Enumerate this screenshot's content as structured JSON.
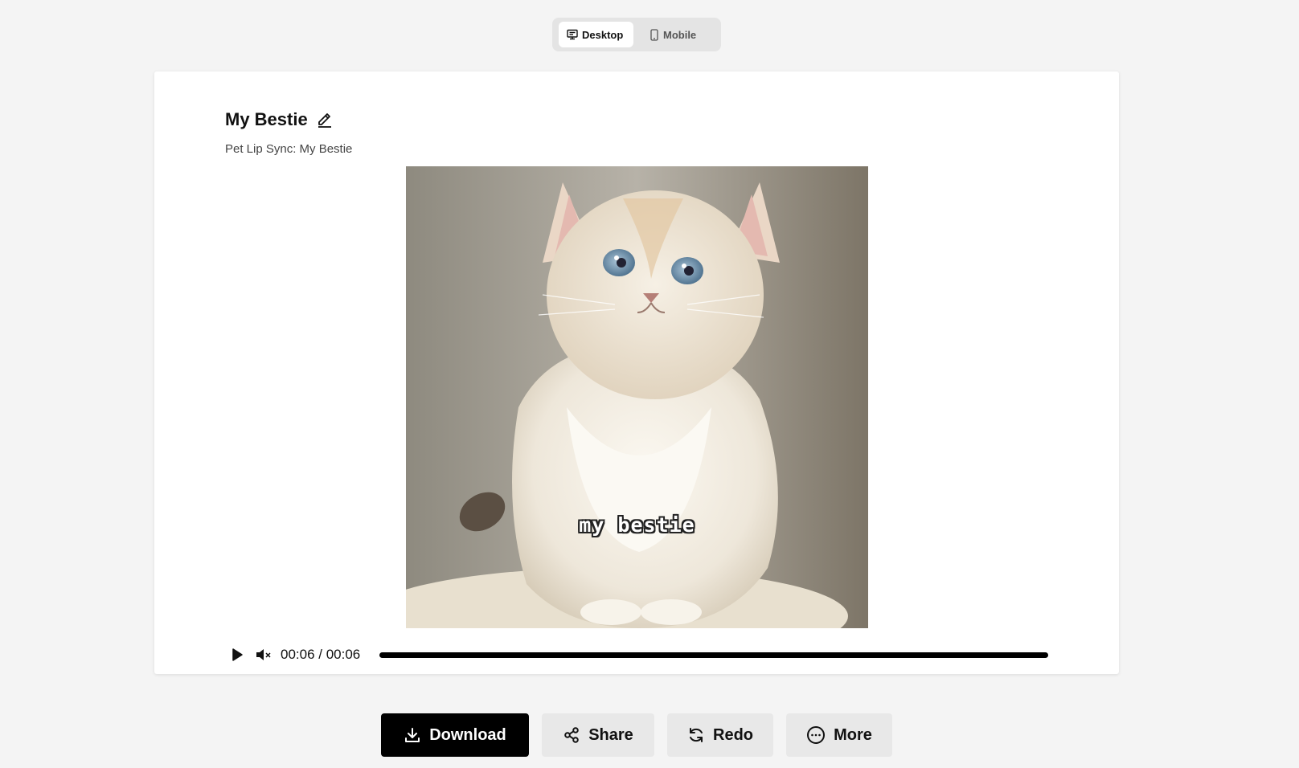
{
  "view_toggle": {
    "desktop_label": "Desktop",
    "mobile_label": "Mobile",
    "selected": "Desktop"
  },
  "card": {
    "title": "My Bestie",
    "subtitle": "Pet Lip Sync: My Bestie",
    "video": {
      "caption": "my bestie",
      "icons": {
        "play": "play-icon",
        "mute": "volume-muted-icon"
      }
    },
    "player": {
      "time_display": "00:06 / 00:06",
      "progress_fraction": 1.0
    }
  },
  "actions": {
    "download": "Download",
    "share": "Share",
    "redo": "Redo",
    "more": "More"
  },
  "colors": {
    "primary_button": "#000000",
    "secondary_button": "#e8e8e8",
    "page_background": "#f4f4f4"
  }
}
